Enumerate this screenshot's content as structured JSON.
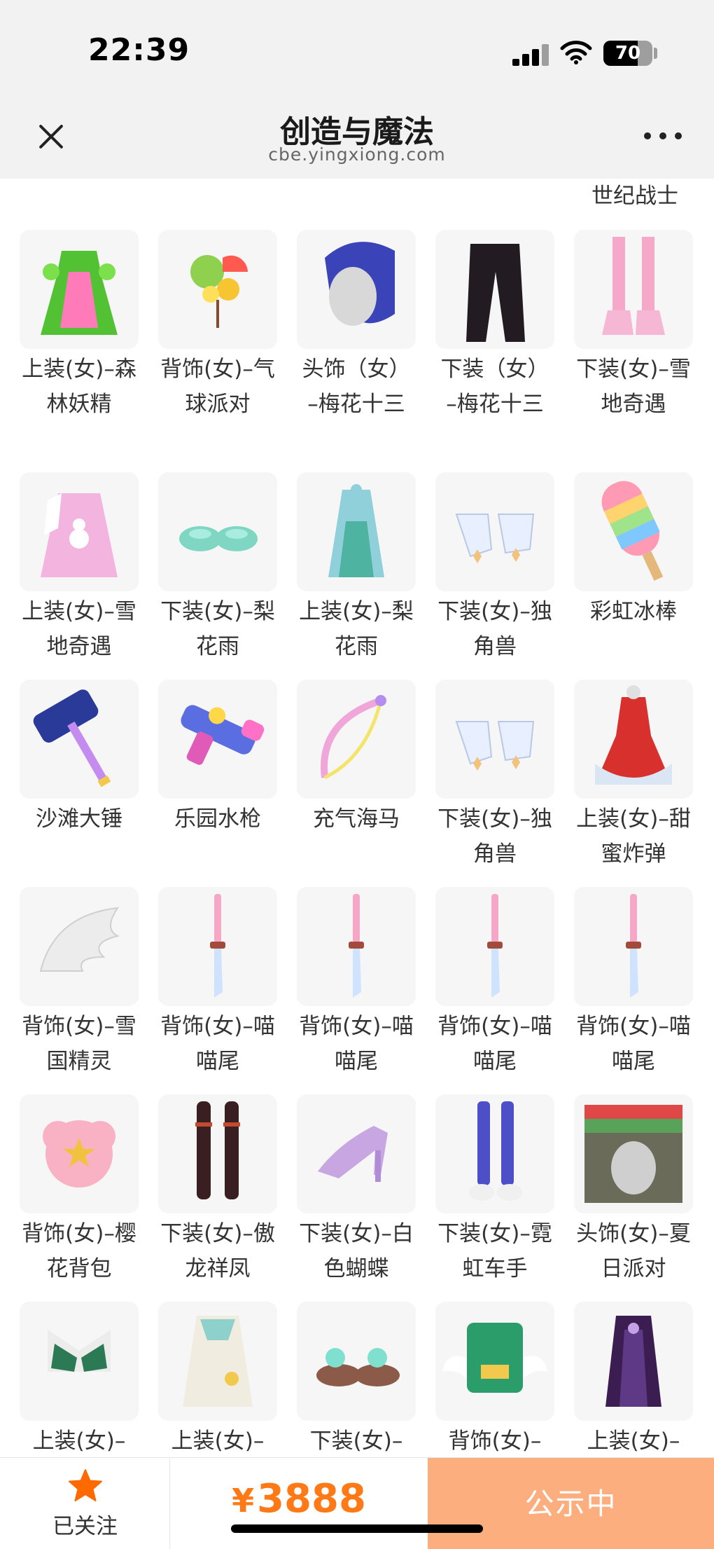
{
  "status_bar": {
    "time": "22:39",
    "battery": "70",
    "battery_level": 0.7
  },
  "header": {
    "title": "创造与魔法",
    "url": "cbe.yingxiong.com"
  },
  "top_partial_label": "世纪战士",
  "items": [
    {
      "label": "上装(女)–森林妖精",
      "icon": "green-forest-dress-icon"
    },
    {
      "label": "背饰(女)–气球派对",
      "icon": "fruit-balloon-icon"
    },
    {
      "label": "头饰（女）–梅花十三",
      "icon": "blue-hair-head-icon"
    },
    {
      "label": "下装（女）–梅花十三",
      "icon": "black-pants-icon"
    },
    {
      "label": "下装(女)–雪地奇遇",
      "icon": "pink-boots-icon"
    },
    {
      "label": "上装(女)–雪地奇遇",
      "icon": "pink-snow-dress-icon"
    },
    {
      "label": "下装(女)–梨花雨",
      "icon": "mint-shoes-icon"
    },
    {
      "label": "上装(女)–梨花雨",
      "icon": "blue-robe-icon"
    },
    {
      "label": "下装(女)–独角兽",
      "icon": "white-boots-icon"
    },
    {
      "label": "彩虹冰棒",
      "icon": "rainbow-popsicle-icon"
    },
    {
      "label": "沙滩大锤",
      "icon": "beach-hammer-icon"
    },
    {
      "label": "乐园水枪",
      "icon": "water-gun-icon"
    },
    {
      "label": "充气海马",
      "icon": "seahorse-bow-icon"
    },
    {
      "label": "下装(女)–独角兽",
      "icon": "white-boots-icon"
    },
    {
      "label": "上装(女)–甜蜜炸弹",
      "icon": "red-dress-icon"
    },
    {
      "label": "背饰(女)–雪国精灵",
      "icon": "white-wing-icon"
    },
    {
      "label": "背饰(女)–喵喵尾",
      "icon": "cat-tail-icon"
    },
    {
      "label": "背饰(女)–喵喵尾",
      "icon": "cat-tail-icon"
    },
    {
      "label": "背饰(女)–喵喵尾",
      "icon": "cat-tail-icon"
    },
    {
      "label": "背饰(女)–喵喵尾",
      "icon": "cat-tail-icon"
    },
    {
      "label": "背饰(女)–樱花背包",
      "icon": "sakura-backpack-icon"
    },
    {
      "label": "下装(女)–傲龙祥凤",
      "icon": "dark-stockings-icon"
    },
    {
      "label": "下装(女)–白色蝴蝶",
      "icon": "high-heel-icon"
    },
    {
      "label": "下装(女)–霓虹车手",
      "icon": "neon-legs-icon"
    },
    {
      "label": "头饰(女)–夏日派对",
      "icon": "summer-hat-icon"
    },
    {
      "label": "上装(女)–",
      "icon": "green-bikini-top-icon"
    },
    {
      "label": "上装(女)–",
      "icon": "white-jacket-icon"
    },
    {
      "label": "下装(女)–",
      "icon": "fluffy-shoes-icon"
    },
    {
      "label": "背饰(女)–",
      "icon": "green-bag-wings-icon"
    },
    {
      "label": "上装(女)–",
      "icon": "purple-dress-icon"
    }
  ],
  "bottom": {
    "follow_label": "已关注",
    "currency": "¥",
    "price": "3888",
    "action_label": "公示中"
  },
  "colors": {
    "accent": "#ff7a16",
    "action_bg": "#fcae7e",
    "header_bg": "#f2f2f2"
  }
}
